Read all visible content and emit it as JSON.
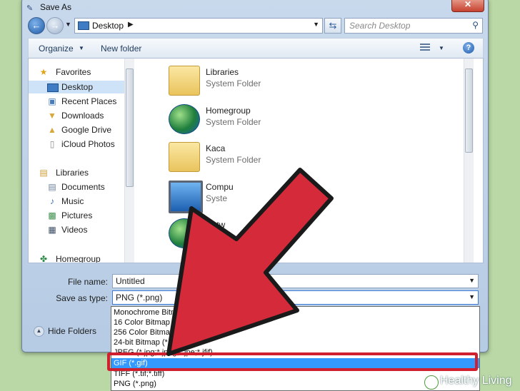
{
  "window": {
    "title": "Save As"
  },
  "address": {
    "location": "Desktop"
  },
  "search": {
    "placeholder": "Search Desktop"
  },
  "toolbar": {
    "organize_label": "Organize",
    "new_folder_label": "New folder"
  },
  "sidebar": {
    "favorites_label": "Favorites",
    "favorites": [
      "Desktop",
      "Recent Places",
      "Downloads",
      "Google Drive",
      "iCloud Photos"
    ],
    "libraries_label": "Libraries",
    "libraries": [
      "Documents",
      "Music",
      "Pictures",
      "Videos"
    ],
    "homegroup_label": "Homegroup"
  },
  "files": [
    {
      "name": "Libraries",
      "type": "System Folder"
    },
    {
      "name": "Homegroup",
      "type": "System Folder"
    },
    {
      "name": "Kaca",
      "type": "System Folder"
    },
    {
      "name": "Compu",
      "type": "Syste"
    },
    {
      "name": "Netw",
      "type": "Syste"
    }
  ],
  "form": {
    "file_name_label": "File name:",
    "file_name_value": "Untitled",
    "save_as_type_label": "Save as type:",
    "save_as_type_value": "PNG (*.png)"
  },
  "hide_folders_label": "Hide Folders",
  "type_options": [
    "Monochrome Bitm",
    "16 Color Bitmap (*",
    "256 Color Bitmap",
    "24-bit Bitmap (*.",
    "JPEG (*.jpg;*.jpeg;*.jpe;*.jfif)",
    "GIF (*.gif)",
    "TIFF (*.tif;*.tiff)",
    "PNG (*.png)"
  ],
  "selected_type_option": "GIF (*.gif)",
  "watermark": "Healthy Living",
  "colors": {
    "arrow": "#d42a3a",
    "highlight": "#d0202f",
    "selection": "#3399ff"
  }
}
